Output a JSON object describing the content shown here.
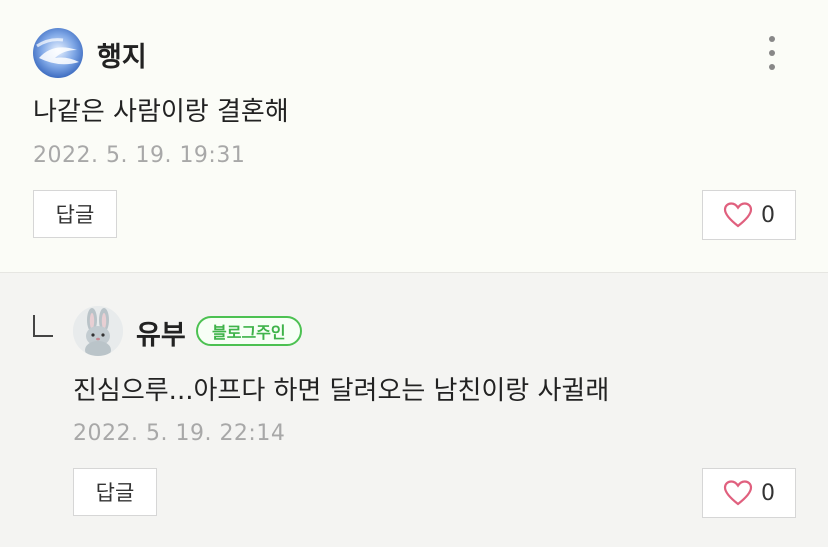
{
  "comments": [
    {
      "author": "행지",
      "text": "나같은 사람이랑 결혼해",
      "date": "2022. 5. 19. 19:31",
      "reply_label": "답글",
      "like_count": "0",
      "menu_icon": "more-vertical-icon"
    },
    {
      "author": "유부",
      "badge": "블로그주인",
      "text": "진심으루...아프다 하면 달려오는 남친이랑 사귈래",
      "date": "2022. 5. 19. 22:14",
      "reply_label": "답글",
      "like_count": "0",
      "reply_indicator_icon": "reply-arrow-icon"
    }
  ],
  "colors": {
    "badge_green": "#4cc152",
    "heart_pink": "#e0607e",
    "date_gray": "#a8a8a8"
  }
}
